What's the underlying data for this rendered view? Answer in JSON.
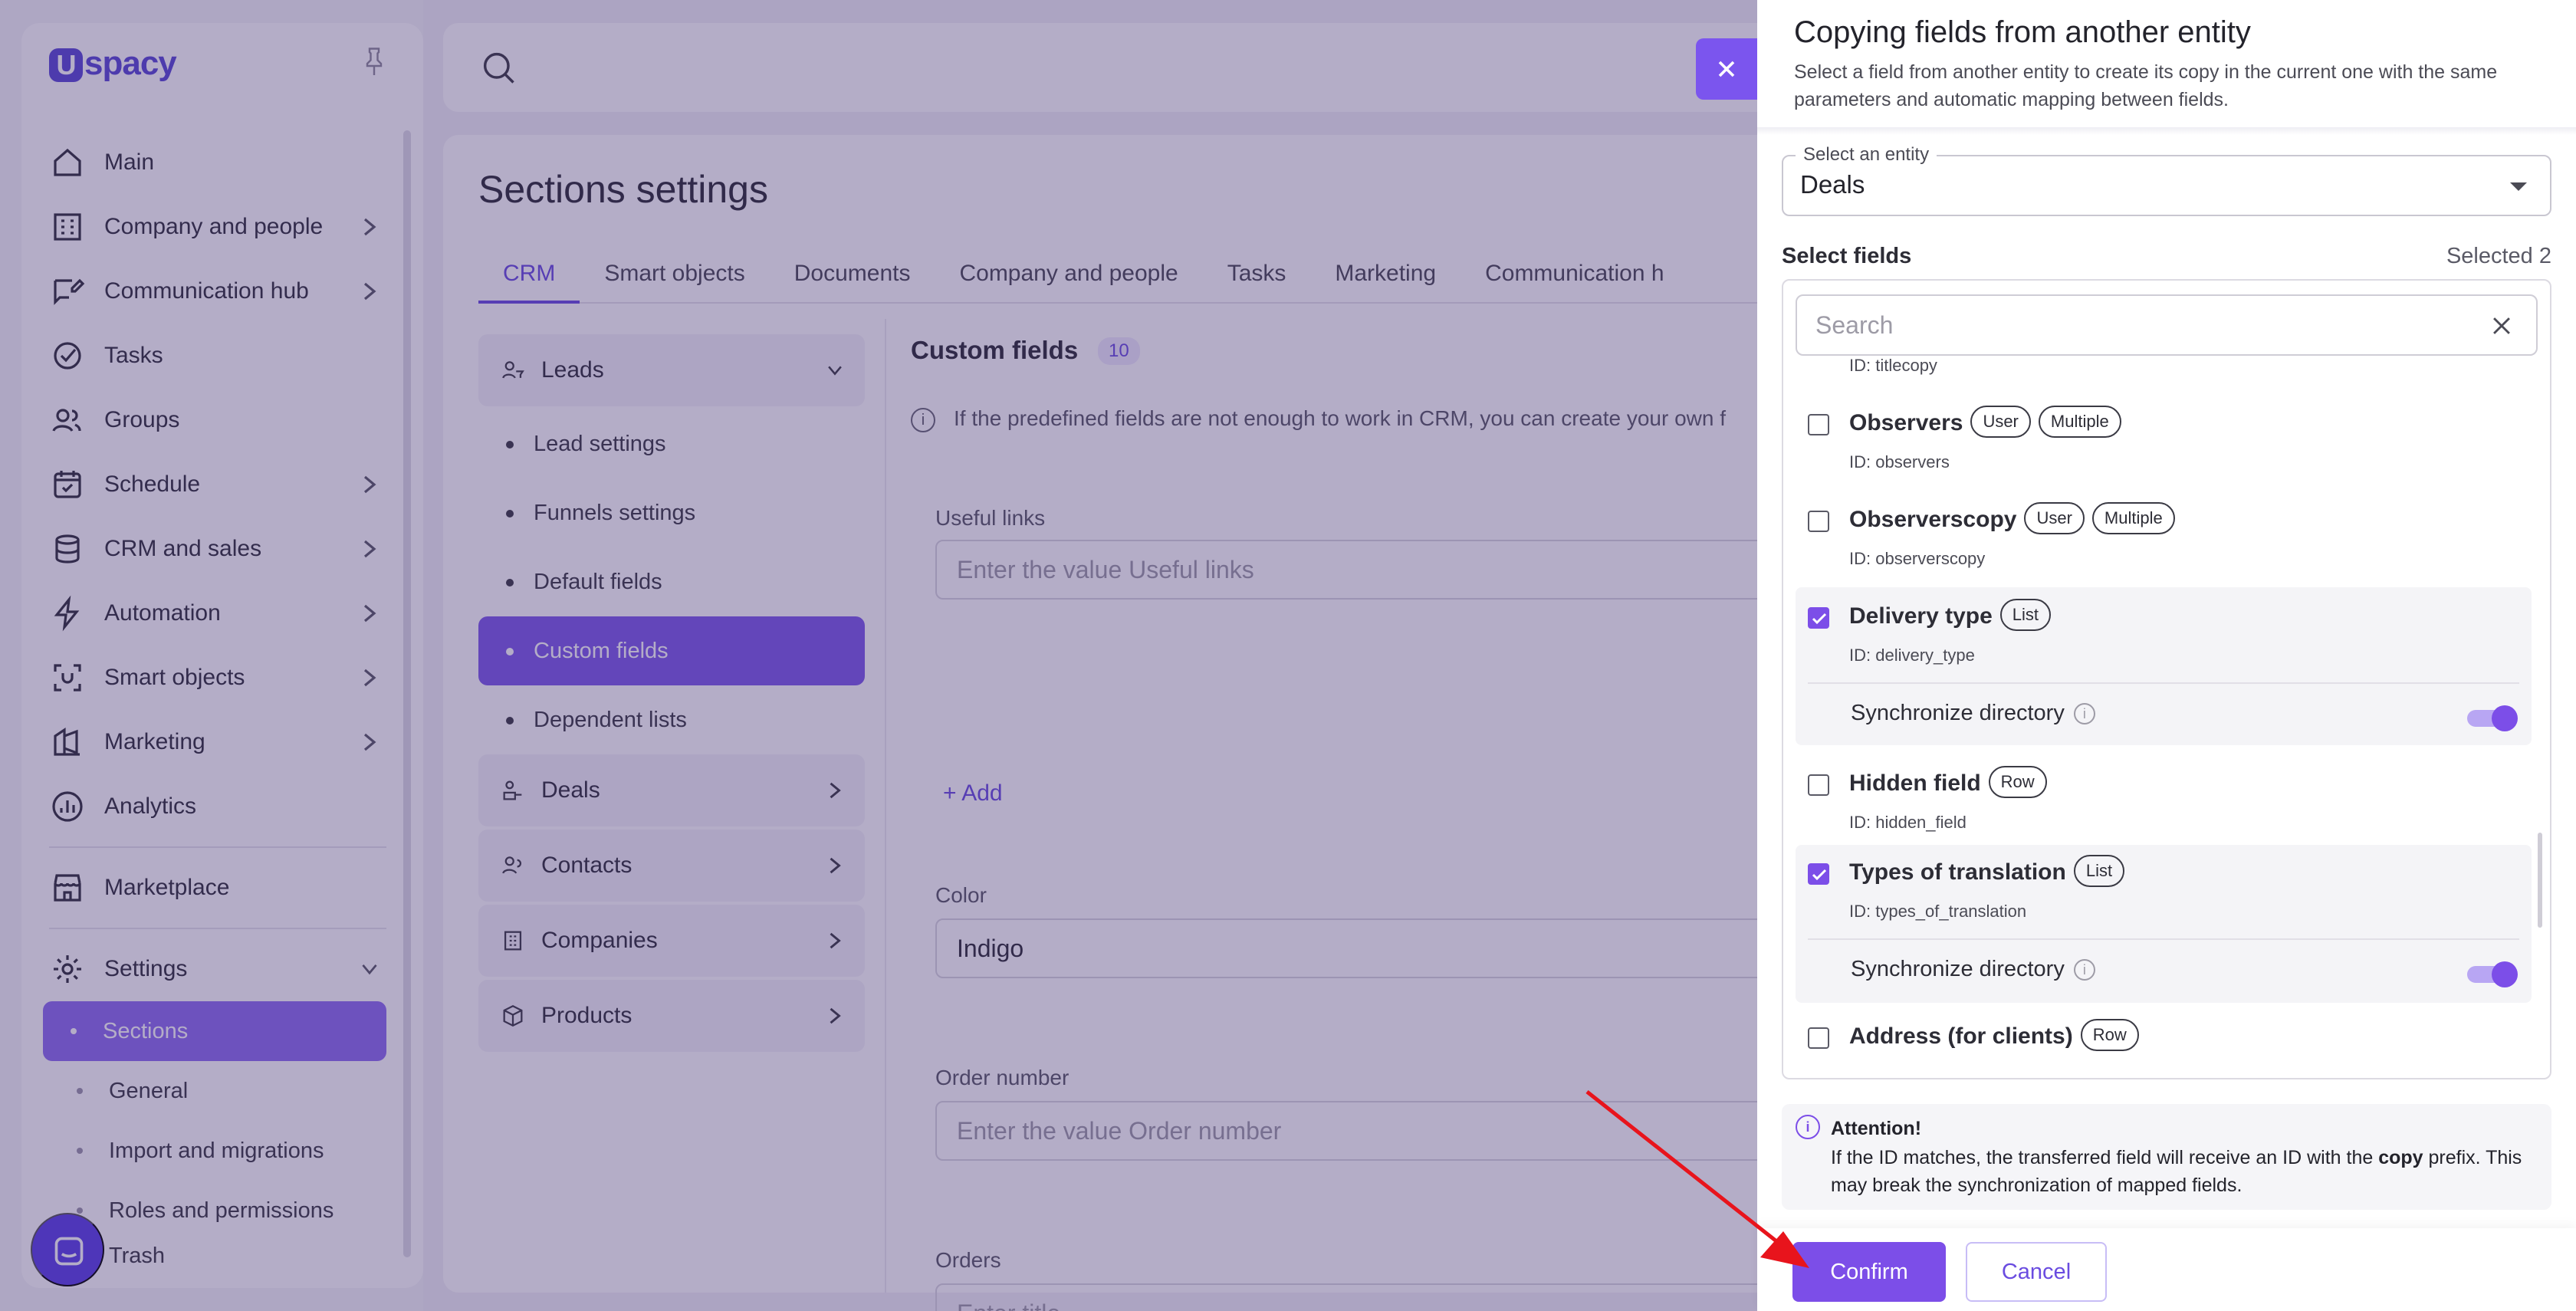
{
  "sidebar": {
    "logo": "spacy",
    "items": [
      {
        "label": "Main"
      },
      {
        "label": "Company and people"
      },
      {
        "label": "Communication hub"
      },
      {
        "label": "Tasks"
      },
      {
        "label": "Groups"
      },
      {
        "label": "Schedule"
      },
      {
        "label": "CRM and sales"
      },
      {
        "label": "Automation"
      },
      {
        "label": "Smart objects"
      },
      {
        "label": "Marketing"
      },
      {
        "label": "Analytics"
      },
      {
        "label": "Marketplace"
      },
      {
        "label": "Settings"
      }
    ],
    "settings_sub": [
      {
        "label": "Sections"
      },
      {
        "label": "General"
      },
      {
        "label": "Import and migrations"
      },
      {
        "label": "Roles and permissions"
      },
      {
        "label": "Trash"
      }
    ]
  },
  "main": {
    "title": "Sections settings",
    "tabs": [
      "CRM",
      "Smart objects",
      "Documents",
      "Company and people",
      "Tasks",
      "Marketing",
      "Communication h"
    ],
    "sections": {
      "leads": "Leads",
      "leads_sub": [
        "Lead settings",
        "Funnels settings",
        "Default fields",
        "Custom fields",
        "Dependent lists"
      ],
      "deals": "Deals",
      "contacts": "Contacts",
      "companies": "Companies",
      "products": "Products"
    },
    "custom_fields": {
      "title": "Custom fields",
      "count": "10",
      "info": "If the predefined fields are not enough to work in CRM, you can create your own f",
      "useful_links_label": "Useful links",
      "useful_links_placeholder": "Enter the value Useful links",
      "add_label": "Add",
      "color_label": "Color",
      "color_value": "Indigo",
      "order_number_label": "Order number",
      "order_number_placeholder": "Enter the value Order number",
      "orders_label": "Orders",
      "orders_placeholder": "Enter title"
    }
  },
  "drawer": {
    "title": "Copying fields from another entity",
    "subtitle": "Select a field from another entity to create its copy in the current one with the same parameters and automatic mapping between fields.",
    "entity_label": "Select an entity",
    "entity_value": "Deals",
    "select_fields_label": "Select fields",
    "selected_count": "Selected 2",
    "search_placeholder": "Search",
    "partial_id": "ID: titlecopy",
    "fields": [
      {
        "name": "Observers",
        "chips": [
          "User",
          "Multiple"
        ],
        "id": "ID: observers",
        "checked": false
      },
      {
        "name": "Observerscopy",
        "chips": [
          "User",
          "Multiple"
        ],
        "id": "ID: observerscopy",
        "checked": false
      },
      {
        "name": "Delivery type",
        "chips": [
          "List"
        ],
        "id": "ID: delivery_type",
        "checked": true,
        "sync_label": "Synchronize directory"
      },
      {
        "name": "Hidden field",
        "chips": [
          "Row"
        ],
        "id": "ID: hidden_field",
        "checked": false
      },
      {
        "name": "Types of translation",
        "chips": [
          "List"
        ],
        "id": "ID: types_of_translation",
        "checked": true,
        "sync_label": "Synchronize directory"
      },
      {
        "name": "Address (for clients)",
        "chips": [
          "Row"
        ],
        "checked": false
      }
    ],
    "attention_title": "Attention!",
    "attention_before": "If the ID matches, the transferred field will receive an ID with the ",
    "attention_bold": "copy",
    "attention_after": " prefix. This may break the synchronization of mapped fields.",
    "confirm_label": "Confirm",
    "cancel_label": "Cancel"
  },
  "colors": {
    "accent": "#7c4ee8",
    "overlay": "#3a286c",
    "annotation_arrow": "#e8141c"
  }
}
